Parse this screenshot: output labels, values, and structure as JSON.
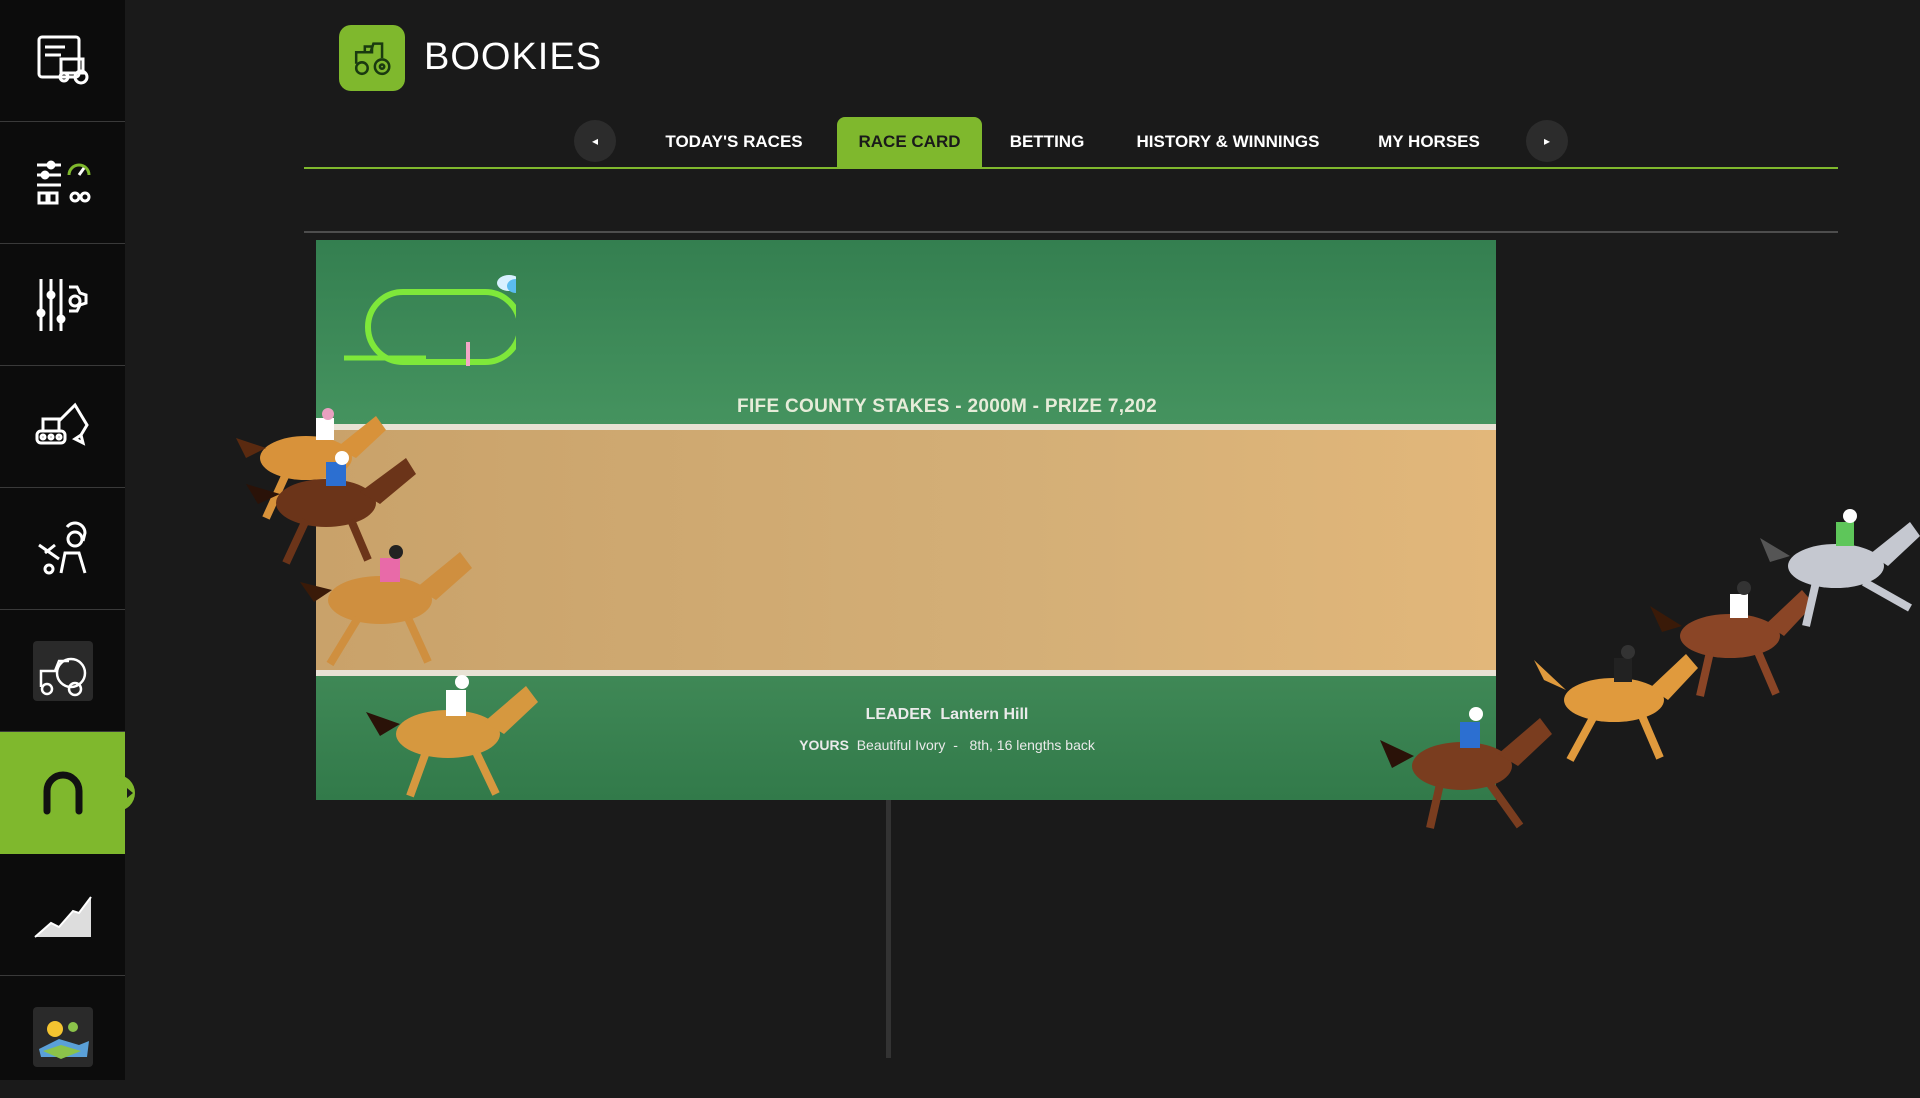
{
  "app": {
    "title": "BOOKIES"
  },
  "sidebar": {
    "items": [
      {
        "name": "vehicle-card-icon"
      },
      {
        "name": "settings-sliders-icon"
      },
      {
        "name": "gear-sliders-icon"
      },
      {
        "name": "excavator-icon"
      },
      {
        "name": "worker-icon"
      },
      {
        "name": "machinery-icon"
      },
      {
        "name": "horseshoe-icon",
        "active": true
      },
      {
        "name": "stats-chart-icon"
      },
      {
        "name": "landscape-icon"
      }
    ]
  },
  "tabs": {
    "prev": "◂",
    "next": "▸",
    "items": [
      {
        "label": "TODAY'S RACES"
      },
      {
        "label": "RACE CARD",
        "active": true
      },
      {
        "label": "BETTING"
      },
      {
        "label": "HISTORY & WINNINGS"
      },
      {
        "label": "MY HORSES"
      }
    ]
  },
  "race": {
    "info": "FIFE COUNTY STAKES  -  2000M  -  PRIZE 7,202",
    "leader_label": "LEADER",
    "leader_name": "Lantern Hill",
    "yours_label": "YOURS",
    "yours_name": "Beautiful Ivory",
    "yours_status": "8th, 16 lengths back"
  },
  "colors": {
    "accent": "#7fb82d",
    "grass": "#3c8a58",
    "dirt": "#d4af77",
    "background": "#1a1a1a",
    "sidebar": "#0c0c0c"
  }
}
